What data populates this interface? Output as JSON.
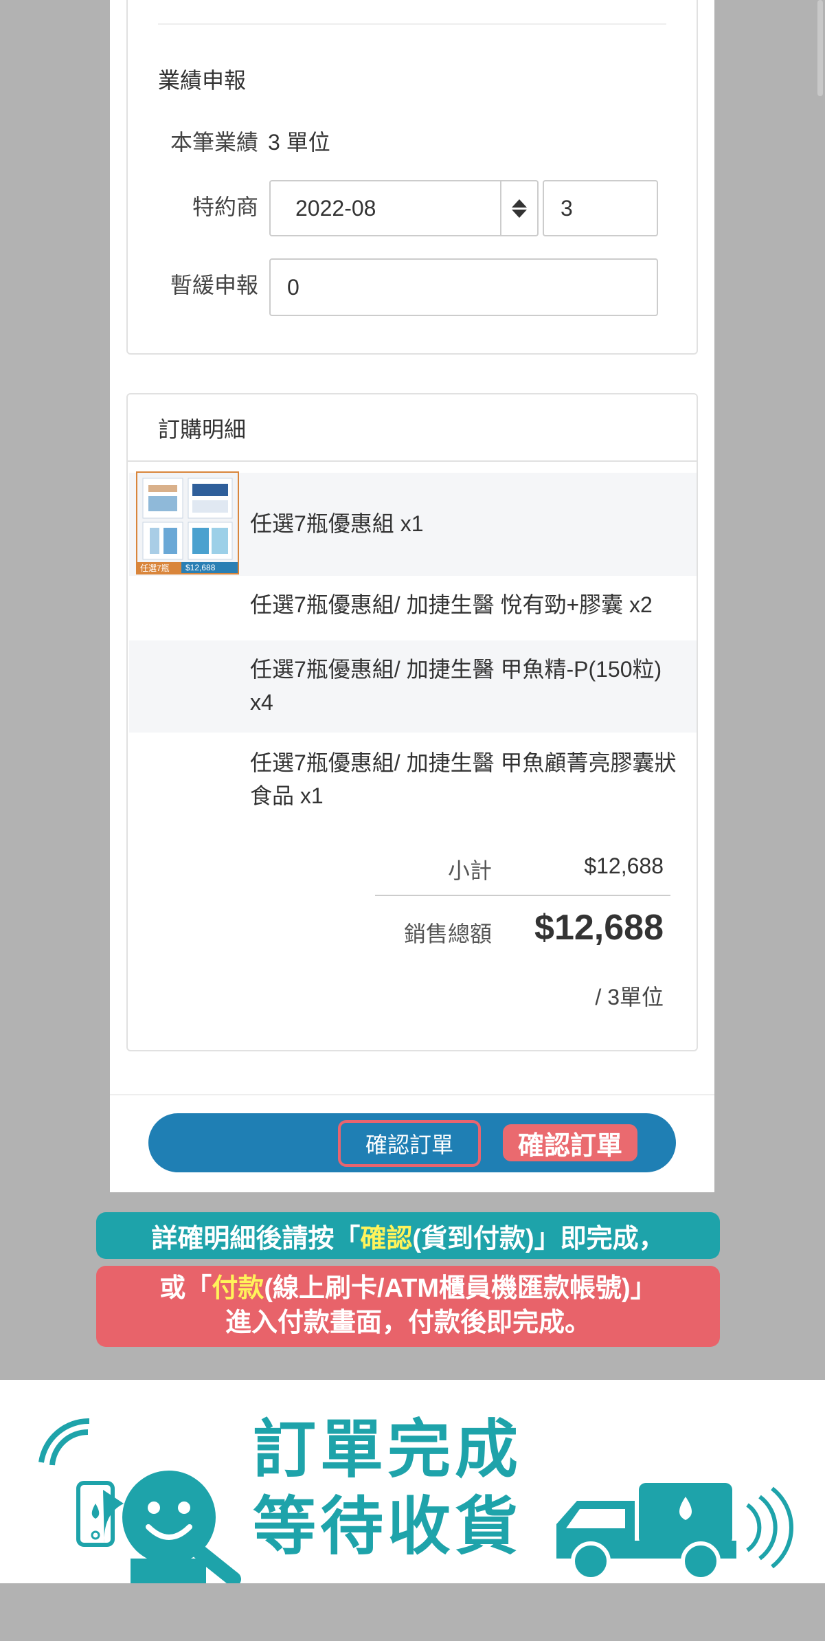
{
  "performance": {
    "section_title": "業績申報",
    "current_label": "本筆業績",
    "current_value": "3 單位",
    "dealer_label": "特約商",
    "dealer_month": "2022-08",
    "dealer_qty": "3",
    "defer_label": "暫緩申報",
    "defer_value": "0"
  },
  "order": {
    "section_title": "訂購明細",
    "thumb_caption_left": "任選7瓶",
    "thumb_caption_price": "$12,688",
    "items": [
      {
        "name": "任選7瓶優惠組 x1"
      },
      {
        "name": "任選7瓶優惠組/ 加捷生醫 悅有勁+膠囊 x2"
      },
      {
        "name": "任選7瓶優惠組/ 加捷生醫 甲魚精-P(150粒) x4"
      },
      {
        "name": "任選7瓶優惠組/ 加捷生醫 甲魚顧菁亮膠囊狀食品 x1"
      }
    ],
    "subtotal_label": "小計",
    "subtotal_value": "$12,688",
    "total_label": "銷售總額",
    "total_value": "$12,688",
    "units_note": "/ 3單位"
  },
  "actions": {
    "confirm_button": "確認訂單",
    "confirm_tag": "確認訂單"
  },
  "instructions": {
    "line1_a": "詳確明細後請按「",
    "line1_highlight": "確認",
    "line1_b": "(貨到付款)」即完成，",
    "line2_a": "或「",
    "line2_highlight": "付款",
    "line2_b": "(線上刷卡/ATM櫃員機匯款帳號)」",
    "line3": "進入付款畫面，付款後即完成。"
  },
  "completion": {
    "title_line1": "訂單完成",
    "title_line2": "等待收貨"
  },
  "colors": {
    "teal": "#1ea3aa",
    "coral": "#e8636a",
    "blue_bar": "#1f7fb4",
    "highlight_yellow": "#fff35a",
    "gray_bg": "#b2b2b2"
  }
}
